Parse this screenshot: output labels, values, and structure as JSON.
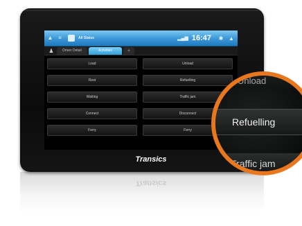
{
  "device": {
    "brand": "Transics",
    "brand_reflection": "Transics"
  },
  "titlebar": {
    "icons": [
      "home-icon",
      "menu-icon",
      "user-icon",
      "signal-icon",
      "settings-icon",
      "arrow-up-icon"
    ],
    "status_text": "All Status",
    "clock": "16:47"
  },
  "tabs": [
    {
      "label": "Driver Detail"
    },
    {
      "label": "Activities",
      "active": true
    },
    {
      "label": "+"
    }
  ],
  "actions": [
    {
      "label": "Load"
    },
    {
      "label": "Unload"
    },
    {
      "label": "Rest"
    },
    {
      "label": "Refuelling"
    },
    {
      "label": "Waiting"
    },
    {
      "label": "Traffic jam"
    },
    {
      "label": "Connect"
    },
    {
      "label": "Disconnect"
    },
    {
      "label": "Ferry"
    },
    {
      "label": "Ferry"
    }
  ],
  "magnifier": {
    "top_partial": "Unload",
    "focus_label": "Refuelling",
    "bottom_partial": "Traffic jam"
  },
  "colors": {
    "accent": "#3d9bd9",
    "magnifier_ring": "#e8771e",
    "bezel": "#0b0b0b"
  }
}
